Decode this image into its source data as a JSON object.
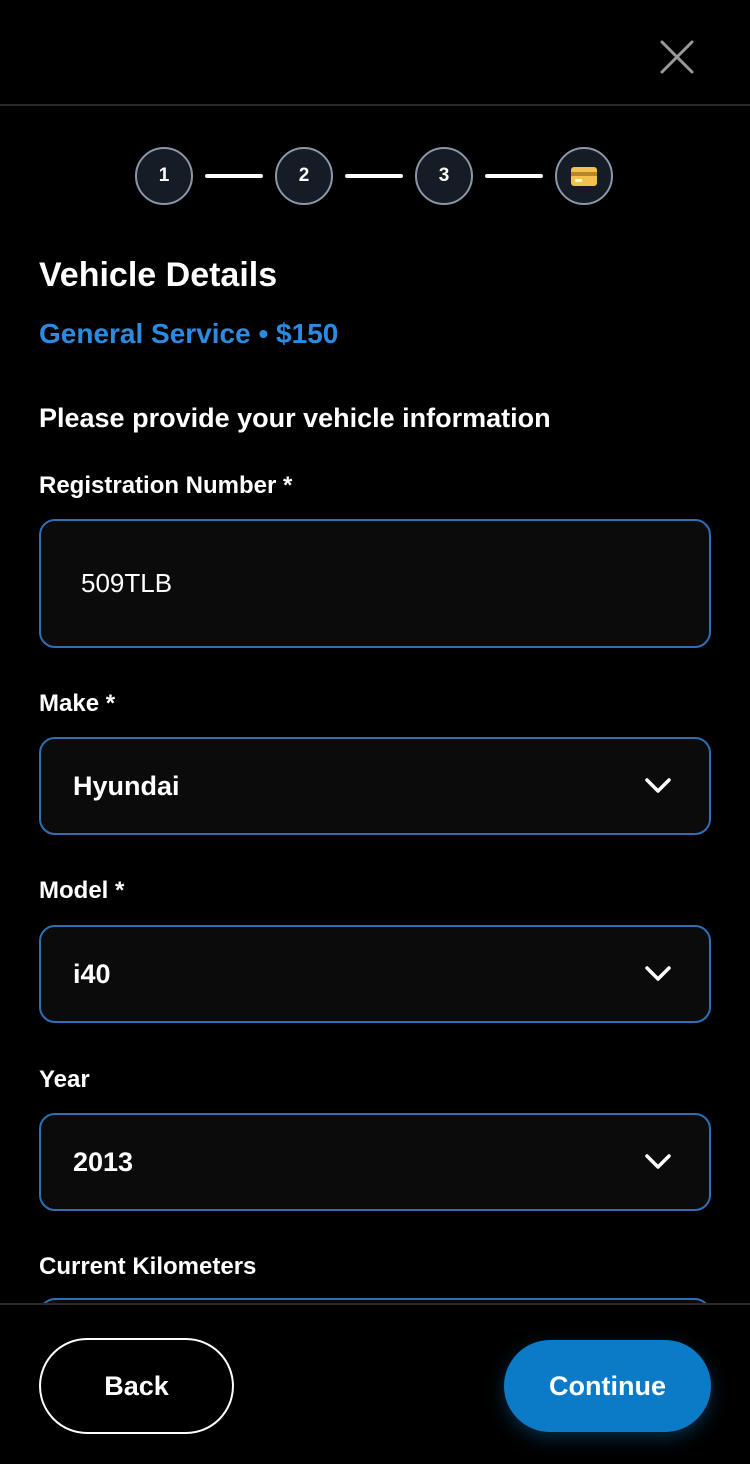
{
  "header": {
    "close_icon": "close-icon"
  },
  "stepper": {
    "steps": [
      {
        "label": "1"
      },
      {
        "label": "2"
      },
      {
        "label": "3"
      },
      {
        "icon": "credit-card-icon"
      }
    ]
  },
  "page": {
    "title": "Vehicle Details",
    "subtitle": "General Service • $150",
    "intro": "Please provide your vehicle information"
  },
  "form": {
    "registration": {
      "label": "Registration Number *",
      "value": "509TLB"
    },
    "make": {
      "label": "Make *",
      "value": "Hyundai"
    },
    "model": {
      "label": "Model *",
      "value": "i40"
    },
    "year": {
      "label": "Year",
      "value": "2013"
    },
    "kilometers": {
      "label": "Current Kilometers"
    }
  },
  "footer": {
    "back_label": "Back",
    "continue_label": "Continue"
  },
  "colors": {
    "accent": "#2b8be0",
    "primary_button": "#0b7bc8",
    "input_border": "#2f6fb3",
    "background": "#000000"
  }
}
